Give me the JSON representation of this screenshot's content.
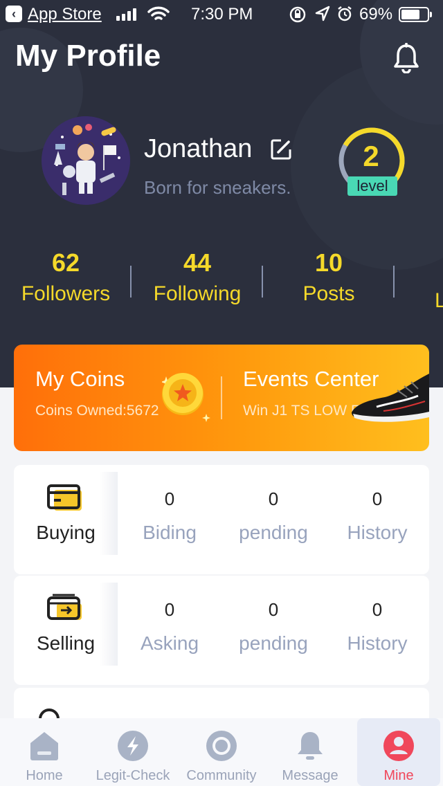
{
  "status_bar": {
    "back_app": "App Store",
    "time": "7:30 PM",
    "battery": "69%",
    "battery_level": 0.69
  },
  "header": {
    "title": "My Profile",
    "icon": "bell-icon"
  },
  "profile": {
    "name": "Jonathan",
    "bio": "Born for sneakers.",
    "level_number": "2",
    "level_label": "level",
    "level_progress": 0.7,
    "colors": {
      "accent_yellow": "#f5d92a",
      "level_badge": "#49d8b4",
      "bio": "#7f8aa6"
    }
  },
  "stats": [
    {
      "value": "62",
      "label": "Followers"
    },
    {
      "value": "44",
      "label": "Following"
    },
    {
      "value": "10",
      "label": "Posts"
    },
    {
      "value": "",
      "label": "L"
    }
  ],
  "banner": {
    "coins_title": "My Coins",
    "coins_sub": "Coins Owned:5672",
    "events_title": "Events Center",
    "events_sub": "Win J1 TS LOW Free"
  },
  "buying": {
    "label": "Buying",
    "cols": [
      {
        "value": "0",
        "label": "Biding"
      },
      {
        "value": "0",
        "label": "pending"
      },
      {
        "value": "0",
        "label": "History"
      }
    ]
  },
  "selling": {
    "label": "Selling",
    "cols": [
      {
        "value": "0",
        "label": "Asking"
      },
      {
        "value": "0",
        "label": "pending"
      },
      {
        "value": "0",
        "label": "History"
      }
    ]
  },
  "tabs": [
    {
      "label": "Home",
      "icon": "home-icon"
    },
    {
      "label": "Legit-Check",
      "icon": "legit-check-icon"
    },
    {
      "label": "Community",
      "icon": "community-icon"
    },
    {
      "label": "Message",
      "icon": "message-bell-icon"
    },
    {
      "label": "Mine",
      "icon": "mine-user-icon",
      "active": true
    }
  ]
}
